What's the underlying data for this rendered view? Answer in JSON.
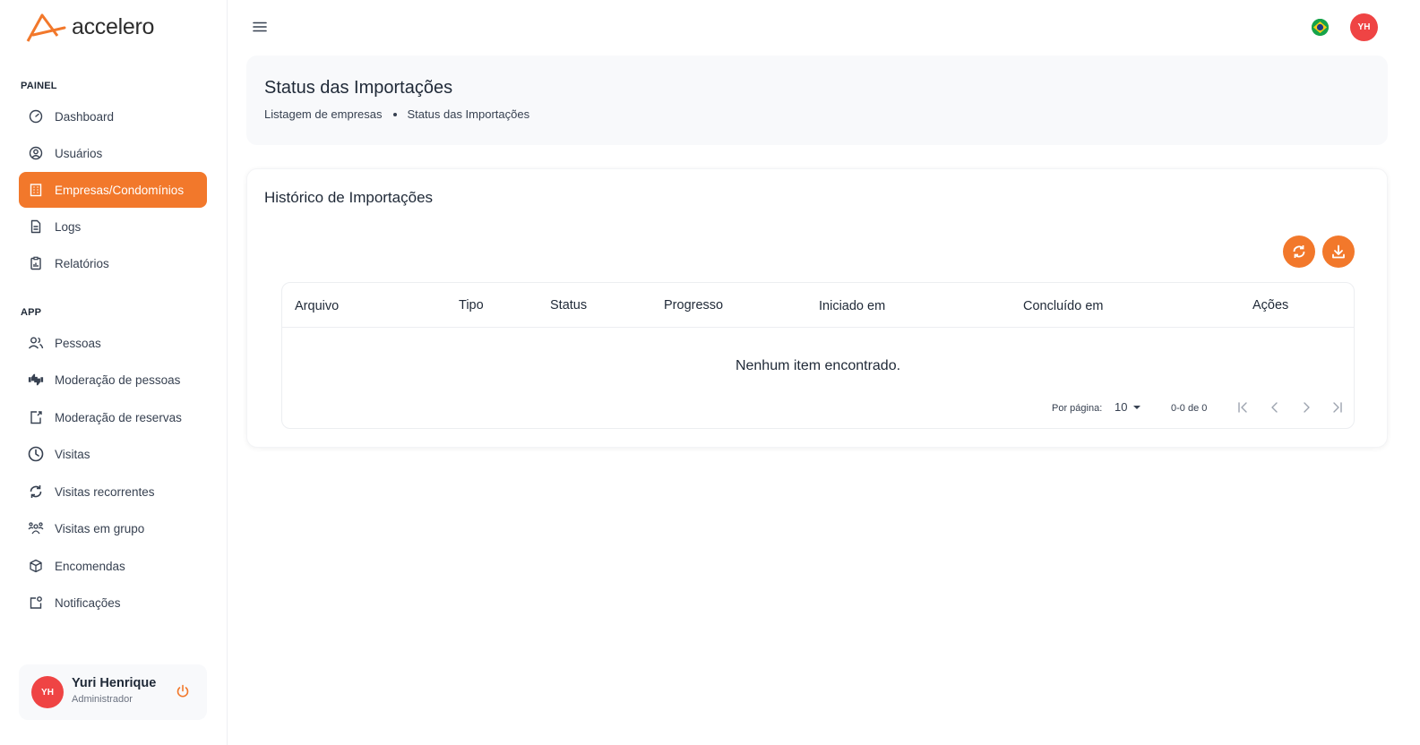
{
  "brand": {
    "name": "accelero",
    "accent": "#f2782b"
  },
  "sidebar": {
    "sections": [
      {
        "label": "PAINEL"
      },
      {
        "label": "APP"
      }
    ],
    "items": [
      {
        "label": "Dashboard",
        "icon": "dashboard-icon"
      },
      {
        "label": "Usuários",
        "icon": "user-circle-icon"
      },
      {
        "label": "Empresas/Condomínios",
        "icon": "building-icon",
        "active": true
      },
      {
        "label": "Logs",
        "icon": "document-icon"
      },
      {
        "label": "Relatórios",
        "icon": "clipboard-chart-icon"
      },
      {
        "label": "Pessoas",
        "icon": "people-icon"
      },
      {
        "label": "Moderação de pessoas",
        "icon": "thumbs-icon"
      },
      {
        "label": "Moderação de reservas",
        "icon": "reservation-icon"
      },
      {
        "label": "Visitas",
        "icon": "clock-icon"
      },
      {
        "label": "Visitas recorrentes",
        "icon": "refresh-icon"
      },
      {
        "label": "Visitas em grupo",
        "icon": "group-icon"
      },
      {
        "label": "Encomendas",
        "icon": "package-icon"
      },
      {
        "label": "Notificações",
        "icon": "notification-icon"
      }
    ]
  },
  "user": {
    "name": "Yuri Henrique",
    "role": "Administrador",
    "initials": "YH"
  },
  "topbar": {
    "initials": "YH"
  },
  "header": {
    "title": "Status das Importações",
    "breadcrumb": [
      "Listagem de empresas",
      "Status das Importações"
    ]
  },
  "card": {
    "title": "Histórico de Importações",
    "columns": [
      "Arquivo",
      "Tipo",
      "Status",
      "Progresso",
      "Iniciado em",
      "Concluído em",
      "Ações"
    ],
    "empty_message": "Nenhum item encontrado.",
    "pagination": {
      "per_page_label": "Por página:",
      "per_page": "10",
      "range": "0-0 de 0"
    }
  }
}
